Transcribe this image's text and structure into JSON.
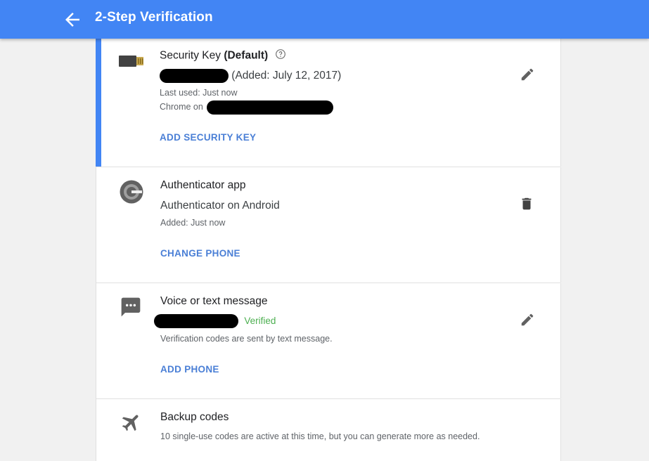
{
  "header": {
    "title": "2-Step Verification",
    "back_icon": "arrow-left-icon"
  },
  "colors": {
    "header_bg": "#4285f4",
    "accent": "#4285f4",
    "action": "#4a7fd6",
    "verified": "#4caf50"
  },
  "security_key": {
    "title_prefix": "Security Key ",
    "title_bold": "(Default)",
    "added": " (Added: July 12, 2017)",
    "last_used": "Last used: Just now",
    "chrome_on": "Chrome on",
    "action": "ADD SECURITY KEY",
    "icon": "security-key-icon",
    "right_icon": "edit-pencil-icon"
  },
  "authenticator": {
    "title": "Authenticator app",
    "device": "Authenticator on Android",
    "added": "Added: Just now",
    "action": "CHANGE PHONE",
    "icon": "authenticator-icon",
    "right_icon": "trash-icon"
  },
  "voice_text": {
    "title": "Voice or text message",
    "status": "Verified",
    "description": "Verification codes are sent by text message.",
    "action": "ADD PHONE",
    "icon": "message-icon",
    "right_icon": "edit-pencil-icon"
  },
  "backup_codes": {
    "title": "Backup codes",
    "description": "10 single-use codes are active at this time, but you can generate more as needed.",
    "icon": "airplane-icon"
  }
}
